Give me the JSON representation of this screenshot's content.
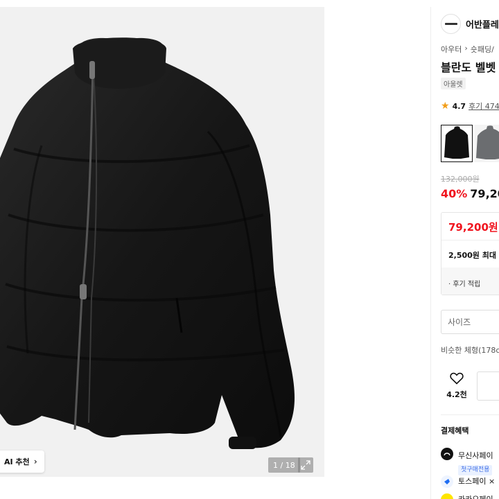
{
  "gallery": {
    "ai_label": "AI 추천",
    "pager": "1 / 18"
  },
  "brand": {
    "name": "어반플레"
  },
  "breadcrumb": {
    "first": "아우터",
    "separator": "›",
    "second": "숏패딩/"
  },
  "product": {
    "title": "블란도 벨벳 ",
    "tag": "아울렛",
    "rating": "4.7",
    "reviews": "후기 474"
  },
  "price": {
    "original": "132,000원",
    "discount": "40%",
    "sale": "79,20"
  },
  "benefit": {
    "price": "79,200원",
    "point": "2,500원 최대",
    "review": "· 후기 적립"
  },
  "options": {
    "size_placeholder": "사이즈",
    "similar": "비슷한 체형(178c"
  },
  "actions": {
    "like_count": "4.2천"
  },
  "payment": {
    "heading": "결제혜택",
    "items": [
      {
        "label": "무신사페이",
        "badge": "첫구매전용",
        "icon": "musinsa-pay-icon",
        "color": "#111111"
      },
      {
        "label": "토스페이 × ",
        "icon": "toss-pay-icon",
        "color": "#1f6df2"
      },
      {
        "label": "카카오페이",
        "icon": "kakao-pay-icon",
        "color": "#fee500"
      }
    ]
  },
  "colors": {
    "accent": "#f0141e",
    "star": "#f29d18",
    "badge_blue": "#3d6ee7"
  }
}
